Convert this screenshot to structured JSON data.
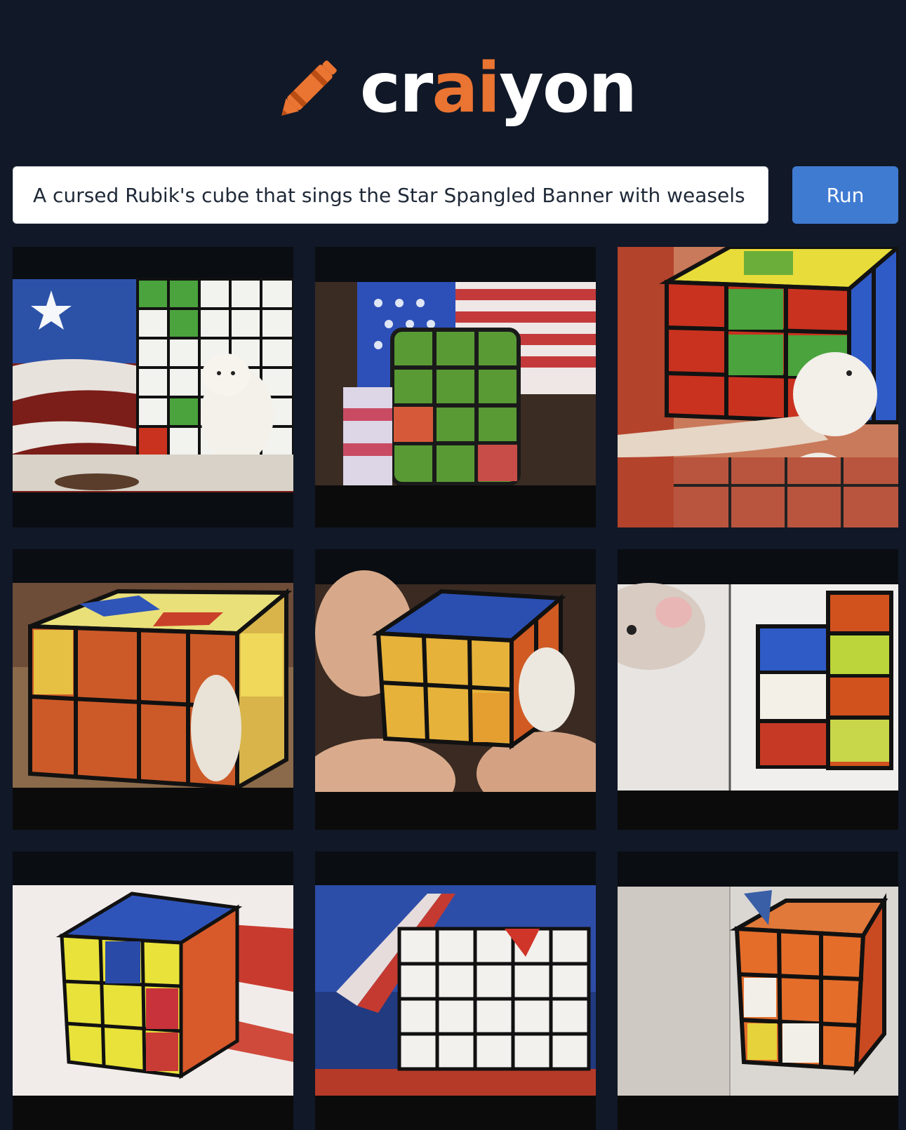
{
  "app": {
    "name_prefix": "cr",
    "name_accent": "ai",
    "name_suffix": "yon",
    "logo_icon": "crayon-icon"
  },
  "prompt": {
    "value": "A cursed Rubik's cube that sings the Star Spangled Banner with weasels"
  },
  "run_button": {
    "label": "Run"
  },
  "colors": {
    "background": "#111827",
    "accent": "#ea7431",
    "button": "#3f7bd1"
  },
  "results": [
    {
      "id": 1
    },
    {
      "id": 2
    },
    {
      "id": 3
    },
    {
      "id": 4
    },
    {
      "id": 5
    },
    {
      "id": 6
    },
    {
      "id": 7
    },
    {
      "id": 8
    },
    {
      "id": 9
    }
  ]
}
